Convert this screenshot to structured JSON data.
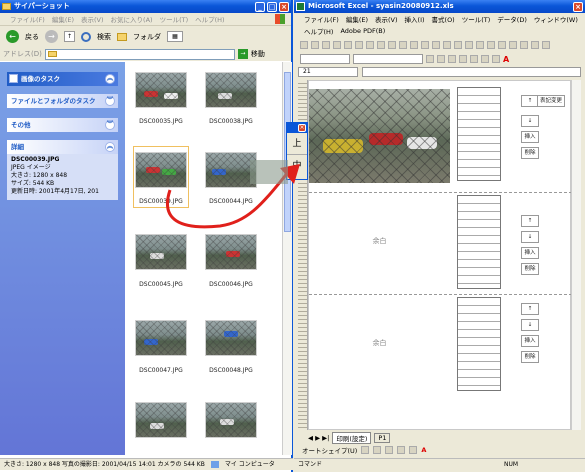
{
  "explorer": {
    "title": "サイパーショット",
    "menu": [
      "ファイル(F)",
      "編集(E)",
      "表示(V)",
      "お気に入り(A)",
      "ツール(T)",
      "ヘルプ(H)"
    ],
    "toolbar": {
      "back": "戻る",
      "search": "検索",
      "folders": "フォルダ"
    },
    "address_label": "アドレス(D)",
    "go_label": "移動",
    "tasks": {
      "image_tasks": "画像のタスク",
      "file_folder_tasks": "ファイルとフォルダのタスク",
      "other": "その他",
      "details": "詳細"
    },
    "details": {
      "filename": "DSC00039.JPG",
      "type": "JPEG イメージ",
      "dimensions": "大きさ: 1280 x 848",
      "size": "サイズ: 544 KB",
      "modified": "更新日時: 2001年4月17日, 201"
    },
    "thumbnails": [
      "DSC00035.JPG",
      "DSC00038.JPG",
      "DSC00039.JPG",
      "DSC00044.JPG",
      "DSC00045.JPG",
      "DSC00046.JPG",
      "DSC00047.JPG",
      "DSC00048.JPG",
      "",
      ""
    ],
    "statusbar": {
      "info": "大きさ: 1280 x 848 写真の撮影日: 2001/04/15 14:01 カメラの 544 KB",
      "computer": "マイ コンピュータ"
    }
  },
  "excel": {
    "title": "Microsoft Excel - syasin20080912.xls",
    "menu": [
      "ファイル(F)",
      "編集(E)",
      "表示(V)",
      "挿入(I)",
      "書式(O)",
      "ツール(T)",
      "データ(D)",
      "ウィンドウ(W)"
    ],
    "menu2": [
      "ヘルプ(H)",
      "Adobe PDF(B)"
    ],
    "namebox": "21",
    "sections": [
      {
        "placeholder": "",
        "buttons": [
          "↑",
          "↓",
          "挿入",
          "削除"
        ],
        "header_button": "表記変更",
        "has_image": true
      },
      {
        "placeholder": "余白",
        "buttons": [
          "↑",
          "↓",
          "挿入",
          "削除"
        ],
        "header_button": "",
        "has_image": false
      },
      {
        "placeholder": "余白",
        "buttons": [
          "↑",
          "↓",
          "挿入",
          "削除"
        ],
        "header_button": "",
        "has_image": false
      }
    ],
    "sheet_tabs": [
      "印刷(設定)",
      "P1"
    ],
    "draw_toolbar": "オートシェイプ(U)",
    "status_left": "コマンド",
    "status_right": "NUM"
  },
  "popup": {
    "up": "上",
    "down": "中"
  },
  "colors": {
    "xp_blue": "#0a56d8",
    "arrow": "#e0201b",
    "task_pane": "#6375d6"
  }
}
